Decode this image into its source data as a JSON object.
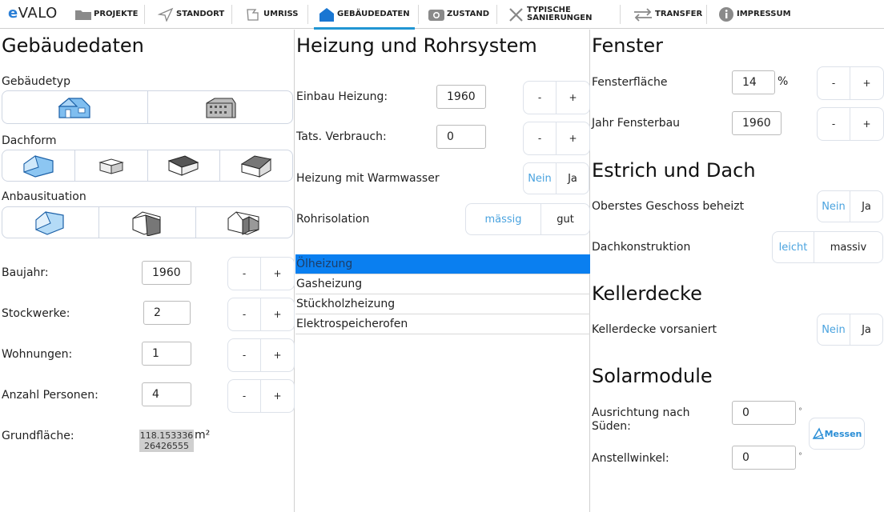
{
  "app": {
    "logo": "eVALO",
    "logo_first": "e",
    "logo_rest": "VALO"
  },
  "nav": {
    "items": [
      {
        "label": "PROJEKTE",
        "icon": "folder-icon"
      },
      {
        "label": "STANDORT",
        "icon": "location-arrow-icon"
      },
      {
        "label": "UMRISS",
        "icon": "outline-icon"
      },
      {
        "label": "GEBÄUDEDATEN",
        "icon": "house-icon",
        "active": true
      },
      {
        "label": "ZUSTAND",
        "icon": "camera-icon"
      },
      {
        "label_line1": "TYPISCHE",
        "label_line2": "SANIERUNGEN",
        "icon": "tools-icon"
      },
      {
        "label": "TRANSFER",
        "icon": "transfer-arrows-icon"
      },
      {
        "label": "IMPRESSUM",
        "icon": "info-icon"
      }
    ],
    "active_color": "#2196d3"
  },
  "gebaeudedaten": {
    "title": "Gebäudedaten",
    "gebaeudetyp_label": "Gebäudetyp",
    "dachform_label": "Dachform",
    "anbau_label": "Anbausituation",
    "baujahr_label": "Baujahr:",
    "baujahr_value": "1960",
    "stockwerke_label": "Stockwerke:",
    "stockwerke_value": "2",
    "wohnungen_label": "Wohnungen:",
    "wohnungen_value": "1",
    "personen_label": "Anzahl Personen:",
    "personen_value": "4",
    "grundflaeche_label": "Grundfläche:",
    "grundflaeche_value_line1": "118.153336",
    "grundflaeche_value_line2": "26426555",
    "grundflaeche_unit": "m²",
    "minus": "-",
    "plus": "+"
  },
  "heizung": {
    "title": "Heizung und Rohrsystem",
    "einbau_label": "Einbau Heizung:",
    "einbau_value": "1960",
    "verbrauch_label": "Tats. Verbrauch:",
    "verbrauch_value": "0",
    "warmwasser_label": "Heizung mit Warmwasser",
    "warmwasser_no": "Nein",
    "warmwasser_yes": "Ja",
    "rohr_label": "Rohrisolation",
    "rohr_opt1": "mässig",
    "rohr_opt2": "gut",
    "types": [
      "Ölheizung",
      "Gasheizung",
      "Stückholzheizung",
      "Elektrospeicherofen"
    ],
    "selected_type": "Ölheizung",
    "minus": "-",
    "plus": "+"
  },
  "fenster": {
    "title": "Fenster",
    "flaeche_label": "Fensterfläche",
    "flaeche_value": "14",
    "flaeche_unit": "%",
    "jahr_label": "Jahr Fensterbau",
    "jahr_value": "1960",
    "minus": "-",
    "plus": "+"
  },
  "estrich": {
    "title": "Estrich und Dach",
    "geschoss_label": "Oberstes Geschoss beheizt",
    "geschoss_no": "Nein",
    "geschoss_yes": "Ja",
    "dach_label": "Dachkonstruktion",
    "dach_opt1": "leicht",
    "dach_opt2": "massiv"
  },
  "keller": {
    "title": "Kellerdecke",
    "label": "Kellerdecke vorsaniert",
    "no": "Nein",
    "yes": "Ja"
  },
  "solar": {
    "title": "Solarmodule",
    "ausrichtung_label_line1": "Ausrichtung nach",
    "ausrichtung_label_line2": "Süden:",
    "ausrichtung_value": "0",
    "anstell_label": "Anstellwinkel:",
    "anstell_value": "0",
    "degree": "°",
    "messen_label": "Messen"
  }
}
